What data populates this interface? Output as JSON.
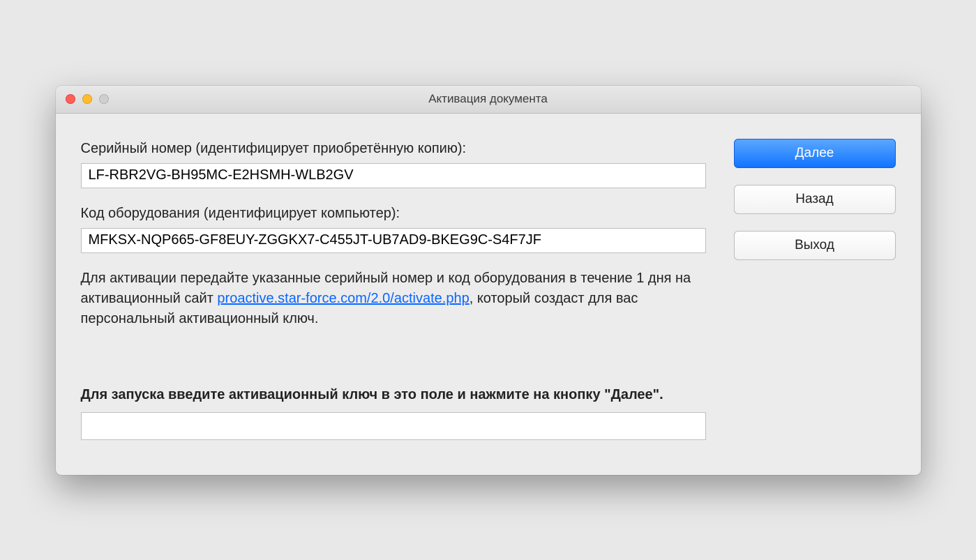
{
  "window": {
    "title": "Активация документа"
  },
  "left": {
    "serial_label": "Серийный номер (идентифицирует приобретённую копию):",
    "serial_value": "LF-RBR2VG-BH95MC-E2HSMH-WLB2GV",
    "hardware_label": "Код оборудования (идентифицирует компьютер):",
    "hardware_value": "MFKSX-NQP665-GF8EUY-ZGGKX7-C455JT-UB7AD9-BKEG9C-S4F7JF",
    "instructions_pre": "Для активации передайте указанные серийный номер и код оборудования в течение 1 дня на активационный сайт ",
    "instructions_link": "proactive.star-force.com/2.0/activate.php",
    "instructions_post": ", который создаст для вас персональный активационный ключ.",
    "bold_instruction": "Для запуска введите активационный ключ в это поле и нажмите на кнопку \"Далее\".",
    "activation_value": ""
  },
  "buttons": {
    "next": "Далее",
    "back": "Назад",
    "exit": "Выход"
  }
}
